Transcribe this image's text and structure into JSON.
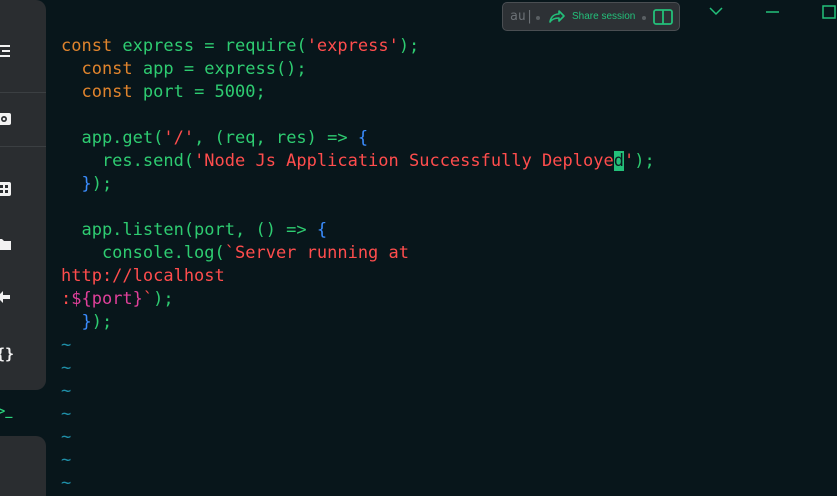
{
  "share_bar": {
    "prompt_text": "au|",
    "share_label": "Share session"
  },
  "editor": {
    "lines": [
      [
        {
          "t": "const",
          "c": "kw"
        },
        {
          "t": " express = ",
          "c": "id"
        },
        {
          "t": "require",
          "c": "id"
        },
        {
          "t": "(",
          "c": "id"
        },
        {
          "t": "'express'",
          "c": "str"
        },
        {
          "t": ");",
          "c": "id"
        }
      ],
      [
        {
          "t": "  const",
          "c": "kw"
        },
        {
          "t": " app = express();",
          "c": "id"
        }
      ],
      [
        {
          "t": "  const",
          "c": "kw"
        },
        {
          "t": " port = ",
          "c": "id"
        },
        {
          "t": "5000",
          "c": "num"
        },
        {
          "t": ";",
          "c": "id"
        }
      ],
      [],
      [
        {
          "t": "  app.get(",
          "c": "id"
        },
        {
          "t": "'/'",
          "c": "str"
        },
        {
          "t": ", (req, res) => ",
          "c": "id"
        },
        {
          "t": "{",
          "c": "brace"
        }
      ],
      [
        {
          "t": "    res.send(",
          "c": "id"
        },
        {
          "t": "'Node Js Application Successfully Deploye",
          "c": "str"
        },
        {
          "t": "d",
          "c": "cursor"
        },
        {
          "t": "'",
          "c": "str"
        },
        {
          "t": ");",
          "c": "id"
        }
      ],
      [
        {
          "t": "  ",
          "c": "id"
        },
        {
          "t": "}",
          "c": "brace"
        },
        {
          "t": ");",
          "c": "id"
        }
      ],
      [],
      [
        {
          "t": "  app.listen(port, () => ",
          "c": "id"
        },
        {
          "t": "{",
          "c": "brace"
        }
      ],
      [
        {
          "t": "    console.log(",
          "c": "id"
        },
        {
          "t": "`Server running at",
          "c": "tpl"
        }
      ],
      [
        {
          "t": "http://localhost",
          "c": "tpl"
        }
      ],
      [
        {
          "t": ":",
          "c": "tpl"
        },
        {
          "t": "${port}",
          "c": "interp"
        },
        {
          "t": "`",
          "c": "tpl"
        },
        {
          "t": ");",
          "c": "id"
        }
      ],
      [
        {
          "t": "  ",
          "c": "id"
        },
        {
          "t": "}",
          "c": "brace"
        },
        {
          "t": ");",
          "c": "id"
        }
      ],
      [
        {
          "t": "~",
          "c": "tilde"
        }
      ],
      [
        {
          "t": "~",
          "c": "tilde"
        }
      ],
      [
        {
          "t": "~",
          "c": "tilde"
        }
      ],
      [
        {
          "t": "~",
          "c": "tilde"
        }
      ],
      [
        {
          "t": "~",
          "c": "tilde"
        }
      ],
      [
        {
          "t": "~",
          "c": "tilde"
        }
      ],
      [
        {
          "t": "~",
          "c": "tilde"
        }
      ]
    ]
  },
  "sidebar": {
    "icons": [
      "menu-icon",
      "settings-chat-icon",
      "grid-icon",
      "folder-icon",
      "workflow-icon",
      "braces-icon"
    ],
    "terminal_glyph": ">_"
  }
}
